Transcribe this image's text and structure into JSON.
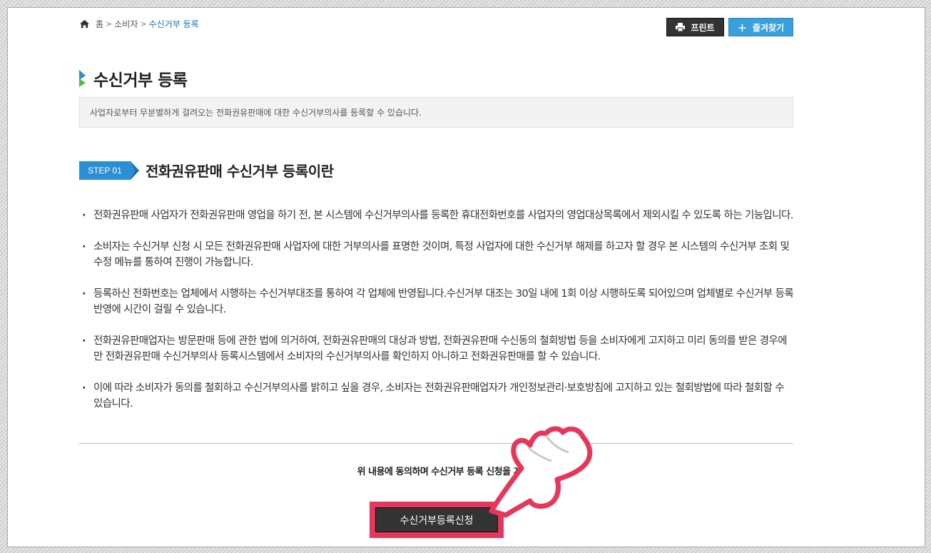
{
  "breadcrumb": {
    "home": "홈",
    "level1": "소비자",
    "current": "수신거부 등록"
  },
  "toolbar": {
    "print_label": "프린트",
    "favorite_label": "즐겨찾기"
  },
  "page": {
    "title": "수신거부 등록",
    "description": "사업자로부터 무분별하게 걸려오는 전화권유판매에 대한 수신거부의사를 등록할 수 있습니다."
  },
  "step": {
    "badge": "STEP 01",
    "heading": "전화권유판매 수신거부 등록이란"
  },
  "content": {
    "items": [
      "전화권유판매 사업자가 전화권유판매 영업을 하기 전, 본 시스템에 수신거부의사를 등록한 휴대전화번호를 사업자의 영업대상목록에서 제외시킬 수 있도록 하는 기능입니다.",
      "소비자는 수신거부 신청 시 모든 전화권유판매 사업자에 대한 거부의사를 표명한 것이며, 특정 사업자에 대한 수신거부 해제를 하고자 할 경우 본 시스템의 수신거부 조회 및 수정 메뉴를 통하여 진행이 가능합니다.",
      "등록하신 전화번호는 업체에서 시행하는 수신거부대조를 통하여 각 업체에 반영됩니다.수신거부 대조는 30일 내에 1회 이상 시행하도록 되어있으며 업체별로 수신거부 등록반영에 시간이 걸릴 수 있습니다.",
      "전화권유판매업자는 방문판매 등에 관한 법에 의거하여, 전화권유판매의 대상과 방법, 전화권유판매 수신동의 철회방법 등을 소비자에게 고지하고 미리 동의를 받은 경우에만 전화권유판매 수신거부의사 등록시스템에서 소비자의 수신거부의사를 확인하지 아니하고 전화권유판매를 할 수 있습니다.",
      "이에 따라 소비자가 동의를 철회하고 수신거부의사를 밝히고 싶을 경우, 소비자는 전화권유판매업자가 개인정보관리·보호방침에 고지하고 있는 철회방법에 따라 철회할 수 있습니다."
    ]
  },
  "agreement": {
    "text": "위 내용에 동의하며 수신거부 등록 신청을 계속 진행합니다."
  },
  "submit": {
    "label": "수신거부등록신청"
  },
  "colors": {
    "accent_blue": "#3aa0dc",
    "step_blue": "#2a8fd4",
    "highlight_red": "#e8365a",
    "dark_button": "#333333"
  },
  "icons": {
    "home": "home-icon",
    "print": "printer-icon",
    "favorite": "plus-icon",
    "pointer": "hand-pointer-icon"
  }
}
